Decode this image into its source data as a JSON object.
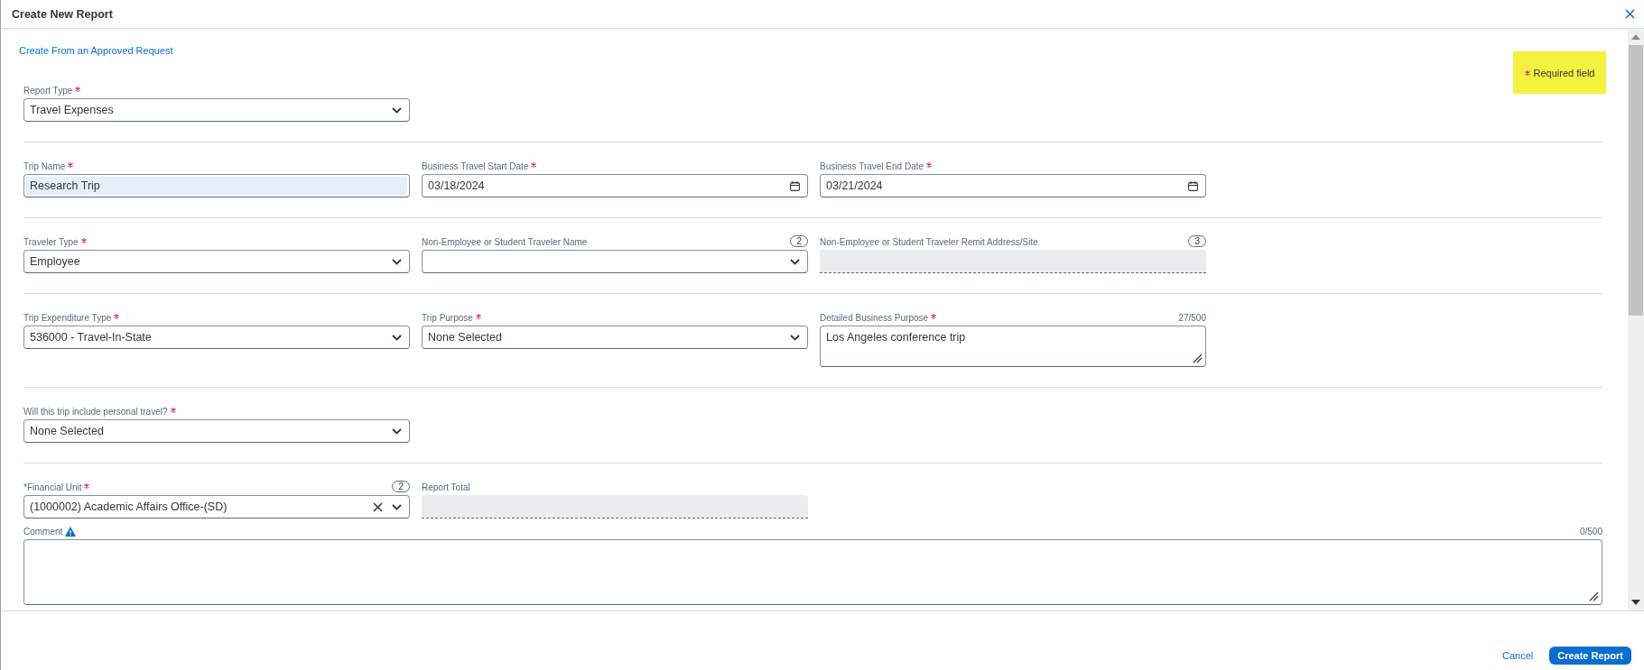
{
  "dialog": {
    "title": "Create New Report"
  },
  "link": "Create From an Approved Request",
  "required_note": {
    "text": "Required field"
  },
  "sections": [
    {
      "fields": [
        {
          "kind": "select",
          "label": "Report Type",
          "required": true,
          "value": "Travel Expenses"
        }
      ]
    },
    {
      "fields": [
        {
          "kind": "text",
          "label": "Trip Name",
          "required": true,
          "value": "Research Trip",
          "highlighted": true
        },
        {
          "kind": "date",
          "label": "Business Travel Start Date",
          "required": true,
          "value": "03/18/2024"
        },
        {
          "kind": "date",
          "label": "Business Travel End Date",
          "required": true,
          "value": "03/21/2024"
        }
      ]
    },
    {
      "fields": [
        {
          "kind": "select",
          "label": "Traveler Type",
          "required": true,
          "value": "Employee"
        },
        {
          "kind": "select",
          "label": "Non-Employee or Student Traveler Name",
          "required": false,
          "count": "2"
        },
        {
          "kind": "readonly",
          "label": "Non-Employee or Student Traveler Remit Address/Site",
          "required": false,
          "count": "3"
        }
      ]
    },
    {
      "fields": [
        {
          "kind": "select",
          "label": "Trip Expenditure Type",
          "required": true,
          "value": "536000 - Travel-In-State"
        },
        {
          "kind": "select",
          "label": "Trip Purpose",
          "required": true,
          "value": "None Selected"
        },
        {
          "kind": "textarea",
          "label": "Detailed Business Purpose",
          "required": true,
          "value": "Los Angeles conference trip",
          "counter": "27/500"
        }
      ]
    },
    {
      "fields": [
        {
          "kind": "select",
          "label": "Will this trip include personal travel?",
          "required": true,
          "value": "None Selected"
        }
      ]
    },
    {
      "fields": [
        {
          "kind": "select",
          "label": "*Financial Unit",
          "required": true,
          "value": "(1000002) Academic Affairs Office-(SD)",
          "count": "2",
          "clearable": true
        },
        {
          "kind": "readonly",
          "label": "Report Total",
          "required": false
        }
      ],
      "comment": {
        "label": "Comment",
        "counter": "0/500",
        "info": true
      }
    }
  ],
  "footer": {
    "cancel": "Cancel",
    "submit": "Create Report"
  }
}
